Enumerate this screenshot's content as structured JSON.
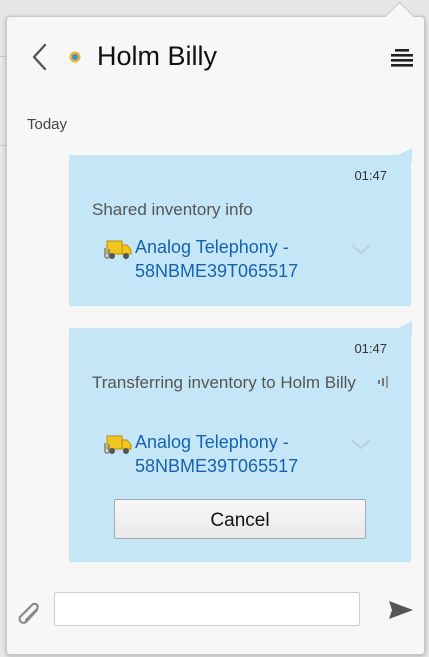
{
  "chat": {
    "contact_name": "Holm Billy",
    "date_label": "Today"
  },
  "messages": [
    {
      "time": "01:47",
      "text": "Shared inventory info",
      "item_line1": "Analog Telephony -",
      "item_line2": "58NBME39T065517"
    },
    {
      "time": "01:47",
      "text": "Transferring inventory to Holm Billy",
      "item_line1": "Analog Telephony -",
      "item_line2": "58NBME39T065517",
      "button_label": "Cancel"
    }
  ],
  "composer": {
    "value": "",
    "placeholder": ""
  },
  "icons": {
    "back": "chevron-left-icon",
    "status": "presence-dot-icon",
    "menu": "menu-icon",
    "truck": "inventory-truck-icon",
    "expand": "chevron-down-icon",
    "signal": "signal-icon",
    "attach": "paperclip-icon",
    "send": "send-icon"
  },
  "colors": {
    "bubble": "#c5e6f7",
    "link": "#1563b0",
    "status_dot": "#e8b33a"
  }
}
